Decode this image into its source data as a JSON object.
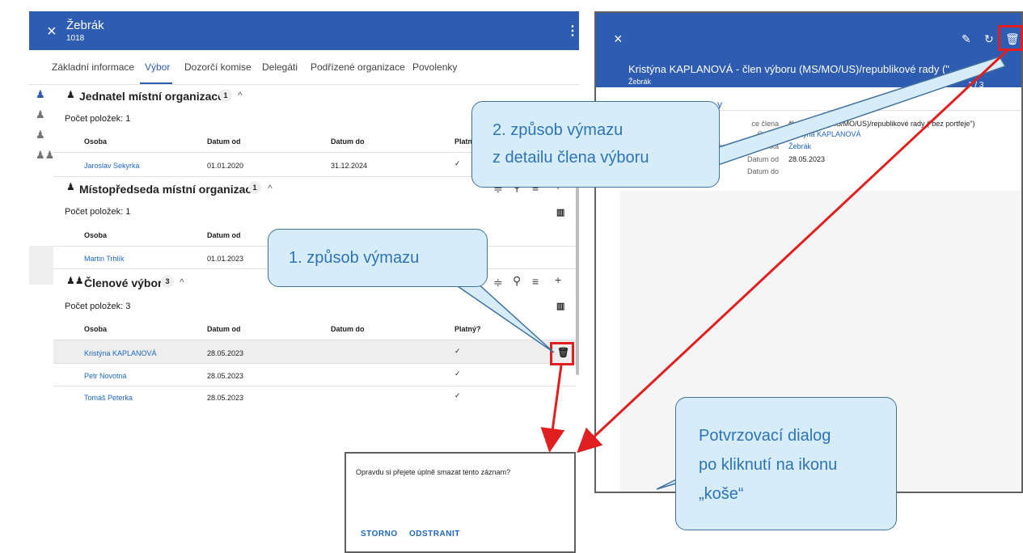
{
  "left_panel": {
    "title": "Žebrák",
    "subtitle": "1018",
    "close_icon": "×",
    "menu_icon": "⋮",
    "tabs": [
      "Základní informace",
      "Výbor",
      "Dozorčí komise",
      "Delegáti",
      "Podřízené organizace",
      "Povolenky"
    ],
    "active_tab": "Výbor",
    "sections": [
      {
        "title": "Jednatel místní organizace",
        "badge": "1",
        "count_label": "Počet položek: 1",
        "columns": [
          "Osoba",
          "Datum od",
          "Datum do",
          "Platný?"
        ],
        "rows": [
          {
            "osoba": "Jaroslav Sekyrka",
            "od": "01.01.2020",
            "do": "31.12.2024",
            "platny": "✓"
          }
        ]
      },
      {
        "title": "Místopředseda místní organizace",
        "badge": "1",
        "count_label": "Počet položek: 1",
        "columns": [
          "Osoba",
          "Datum od"
        ],
        "rows": [
          {
            "osoba": "Martin Trhlík",
            "od": "01.01.2023"
          }
        ]
      },
      {
        "title": "Členové výboru",
        "badge": "3",
        "count_label": "Počet položek: 3",
        "columns": [
          "Osoba",
          "Datum od",
          "Datum do",
          "Platný?"
        ],
        "rows": [
          {
            "osoba": "Kristýna KAPLANOVÁ",
            "od": "28.05.2023",
            "do": "",
            "platny": "✓"
          },
          {
            "osoba": "Petr Novotná",
            "od": "28.05.2023",
            "do": "",
            "platny": "✓"
          },
          {
            "osoba": "Tomáš Peterka",
            "od": "28.05.2023",
            "do": "",
            "platny": "✓"
          }
        ]
      }
    ],
    "trunc_header": "Platný"
  },
  "right_panel": {
    "close_icon": "×",
    "title": "Kristýna KAPLANOVÁ - člen výboru (MS/MO/US)/republikové rady (\"...",
    "subtitle": "Žebrák",
    "pager": "1 / 3",
    "section_stub": "y",
    "details": [
      {
        "label": "ce člena",
        "value": "člen výboru (MS/MO/US)/republikové rady (\"bez portfeje\")",
        "link": false
      },
      {
        "label": "Osoba",
        "value": "Kristýna KAPLANOVÁ",
        "link": true
      },
      {
        "label": "ganizační jednotka",
        "value": "Žebrák",
        "link": true
      },
      {
        "label": "Datum od",
        "value": "28.05.2023",
        "link": false
      },
      {
        "label": "Datum do",
        "value": "",
        "link": false
      }
    ]
  },
  "dialog": {
    "message": "Opravdu si přejete úplně smazat tento záznam?",
    "cancel": "STORNO",
    "confirm": "ODSTRANIT"
  },
  "callouts": {
    "second_way_line1": "2. způsob výmazu",
    "second_way_line2": "z detailu člena výboru",
    "first_way": "1. způsob výmazu",
    "confirm_line1": "Potvrzovací dialog",
    "confirm_line2": "po kliknutí na ikonu",
    "confirm_line3": "„koše“"
  },
  "colors": {
    "header_blue": "#2d5cb1",
    "link_blue": "#1e67c1",
    "callout_fill": "#d6ecf9",
    "callout_text": "#2e74b5",
    "highlight_red": "#e02020"
  },
  "icons": [
    "close-icon",
    "kebab-menu-icon",
    "person-icon",
    "people-icon",
    "filter-icon",
    "search-icon",
    "list-icon",
    "add-icon",
    "columns-icon",
    "trash-icon",
    "pencil-icon",
    "refresh-icon"
  ]
}
